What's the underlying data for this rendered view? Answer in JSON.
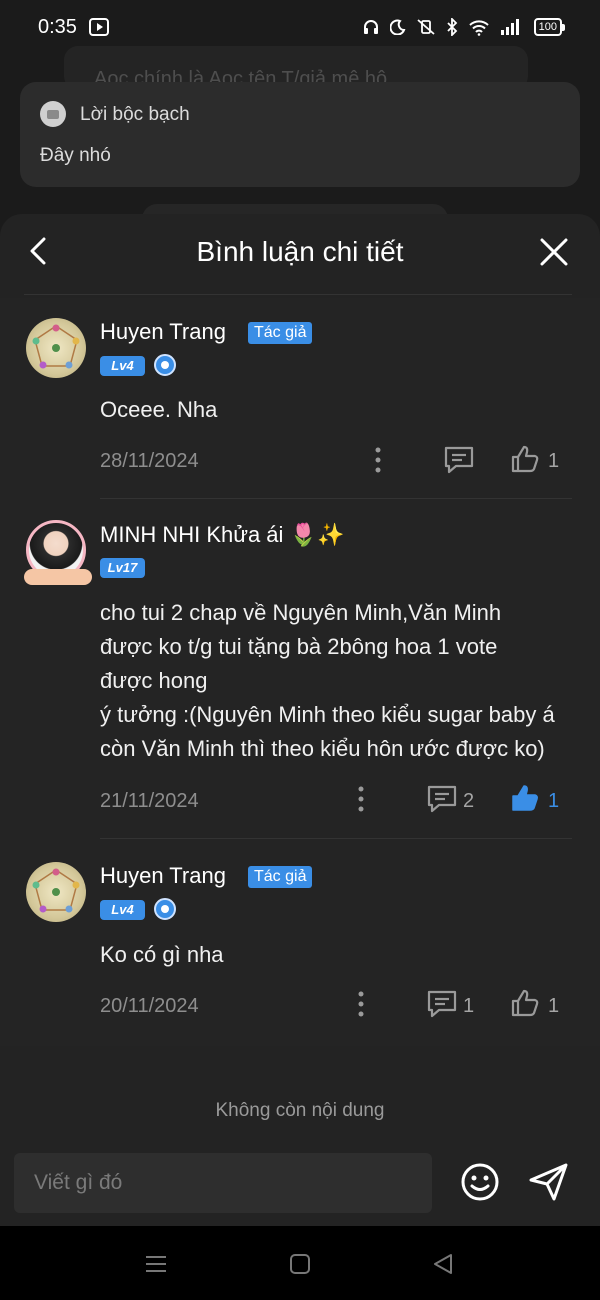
{
  "status_bar": {
    "time": "0:35",
    "battery": "100"
  },
  "background": {
    "faded_text": "Aoc chính là Aoc tên T/giả mê hô",
    "card_title": "Lời bộc bạch",
    "card_text": "Đây nhó"
  },
  "sheet": {
    "title": "Bình luận chi tiết"
  },
  "comments": [
    {
      "user": "Huyen Trang",
      "author_badge": "Tác giả",
      "level": "Lv4",
      "text": "Oceee. Nha",
      "date": "28/11/2024",
      "replies": "",
      "likes": "1",
      "liked": false
    },
    {
      "user": "MINH NHI Khửa ái 🌷✨",
      "author_badge": "",
      "level": "Lv17",
      "text_lines": [
        "cho tui 2 chap về Nguyên Minh,Văn Minh",
        "được ko t/g tui tặng bà 2bông hoa 1 vote",
        "được hong",
        "ý tưởng :(Nguyên Minh theo kiểu sugar baby á",
        "còn Văn Minh thì theo kiểu hôn ước được ko)"
      ],
      "date": "21/11/2024",
      "replies": "2",
      "likes": "1",
      "liked": true
    },
    {
      "user": "Huyen Trang",
      "author_badge": "Tác giả",
      "level": "Lv4",
      "text": "Ko có gì nha",
      "date": "20/11/2024",
      "replies": "1",
      "likes": "1",
      "liked": false
    }
  ],
  "footer": {
    "no_more": "Không còn nội dung"
  },
  "input": {
    "placeholder": "Viết gì đó",
    "value": ""
  },
  "colors": {
    "accent": "#3a8ee6",
    "sheet_bg": "#232323",
    "text_muted": "#8e8e8e"
  },
  "icons": [
    "back-icon",
    "close-icon",
    "more-icon",
    "reply-icon",
    "like-icon",
    "emoji-icon",
    "send-icon",
    "menu-icon",
    "home-icon",
    "back-nav-icon"
  ]
}
